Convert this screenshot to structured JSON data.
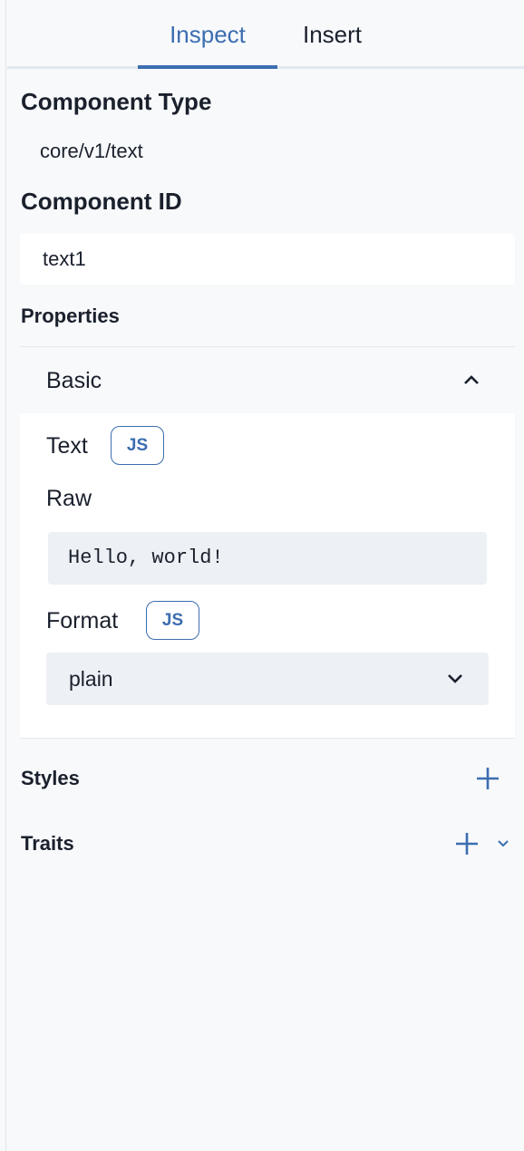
{
  "tabs": [
    {
      "label": "Inspect",
      "active": true
    },
    {
      "label": "Insert",
      "active": false
    }
  ],
  "component_type": {
    "title": "Component Type",
    "value": "core/v1/text"
  },
  "component_id": {
    "title": "Component ID",
    "value": "text1"
  },
  "properties": {
    "title": "Properties",
    "group": {
      "label": "Basic",
      "expanded": true,
      "text_field": {
        "label": "Text",
        "js_badge": "JS",
        "mode_label": "Raw",
        "value": "Hello, world!"
      },
      "format_field": {
        "label": "Format",
        "js_badge": "JS",
        "selected": "plain"
      }
    }
  },
  "styles": {
    "title": "Styles"
  },
  "traits": {
    "title": "Traits"
  },
  "colors": {
    "accent": "#3b6db0",
    "background": "#f7f9fb",
    "input_bg": "#edf0f5",
    "text": "#1a202c"
  }
}
